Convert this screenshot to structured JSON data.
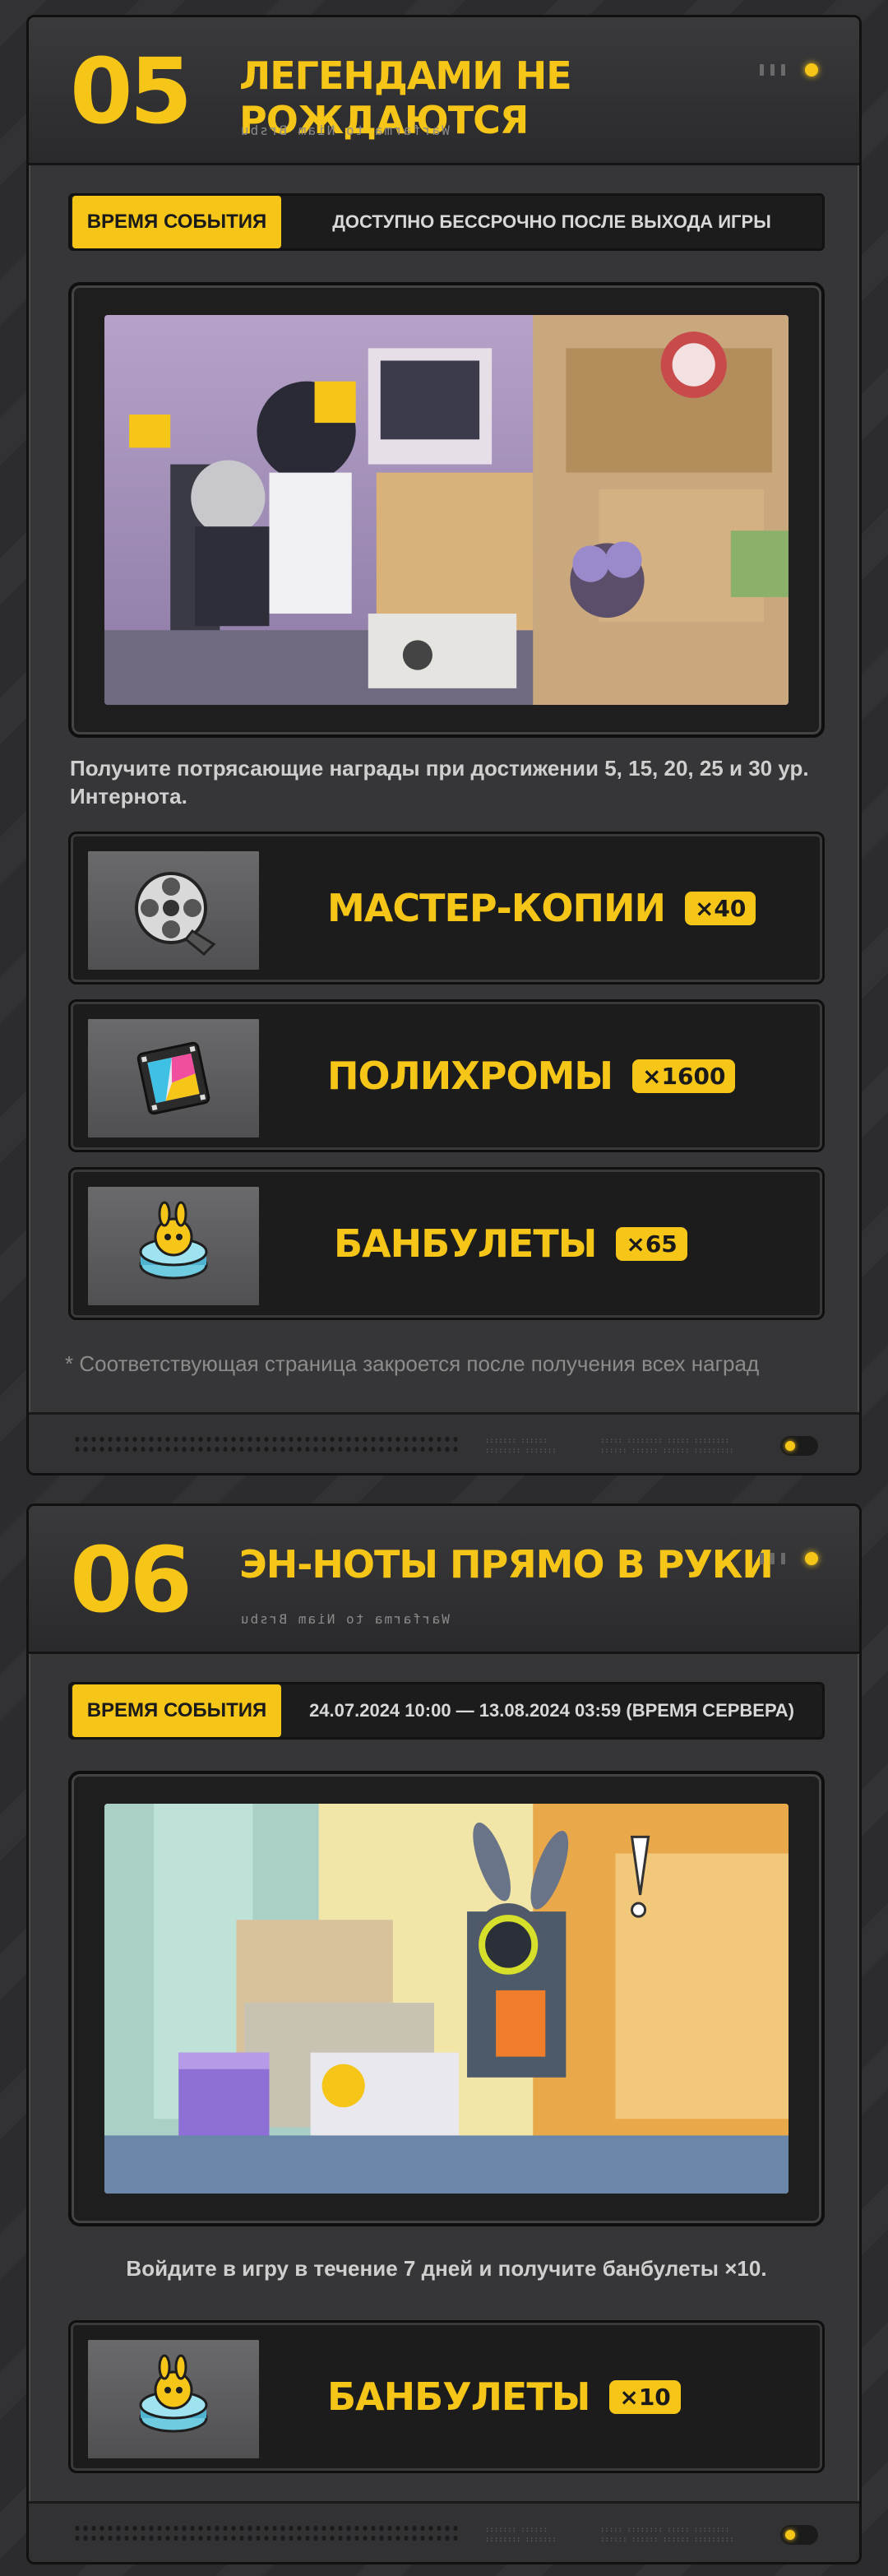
{
  "colors": {
    "accent": "#f5c518",
    "panel": "#363638",
    "dark": "#1c1c1d"
  },
  "section5": {
    "number": "05",
    "title": "ЛЕГЕНДАМИ НЕ РОЖДАЮТСЯ",
    "subtitle": "Warfarma to Niam Brsbu",
    "time_label": "ВРЕМЯ СОБЫТИЯ",
    "time_value": "ДОСТУПНО БЕССРОЧНО ПОСЛЕ ВЫХОДА ИГРЫ",
    "description": "Получите потрясающие награды при достижении 5, 15, 20, 25 и 30 ур. Интернота.",
    "rewards": [
      {
        "name": "МАСТЕР-КОПИИ",
        "qty": "×40",
        "icon": "film-reel-icon"
      },
      {
        "name": "ПОЛИХРОМЫ",
        "qty": "×1600",
        "icon": "polychrome-film-icon"
      },
      {
        "name": "БАНБУЛЕТЫ",
        "qty": "×65",
        "icon": "boopon-coin-icon"
      }
    ],
    "note": "* Соответствующая страница закроется после получения всех наград"
  },
  "section6": {
    "number": "06",
    "title": "ЭН-НОТЫ ПРЯМО В РУКИ",
    "subtitle": "Warfarma to Niam Brsbu",
    "time_label": "ВРЕМЯ СОБЫТИЯ",
    "time_value": "24.07.2024 10:00 — 13.08.2024 03:59 (ВРЕМЯ СЕРВЕРА)",
    "description": "Войдите в игру в течение 7 дней и получите банбулеты ×10.",
    "rewards": [
      {
        "name": "БАНБУЛЕТЫ",
        "qty": "×10",
        "icon": "boopon-coin-icon"
      }
    ]
  }
}
